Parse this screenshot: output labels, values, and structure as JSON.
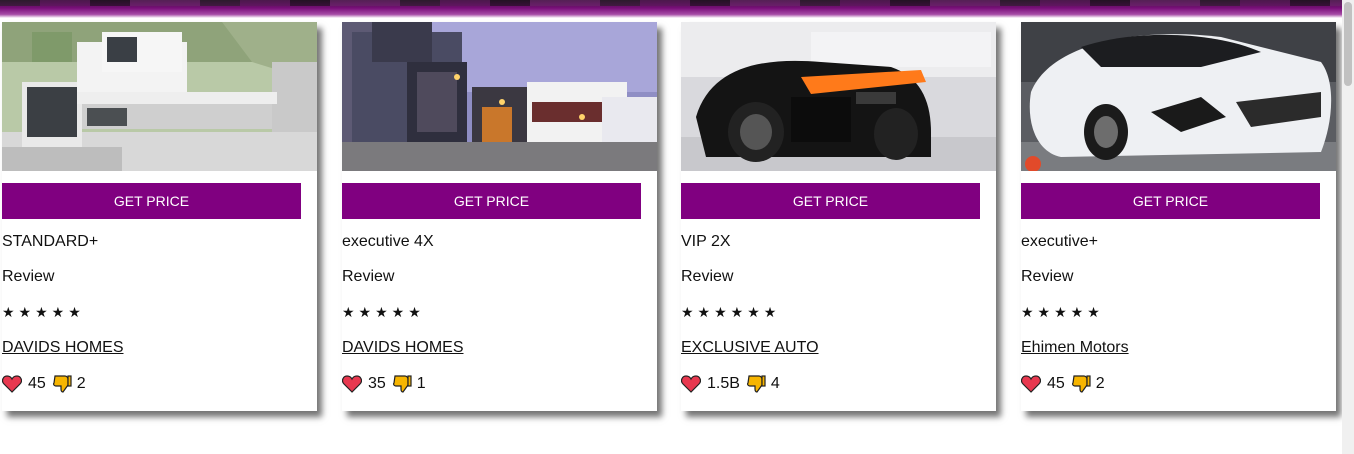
{
  "cards": [
    {
      "image_alt": "modern house",
      "button": "GET PRICE",
      "title": "STANDARD+",
      "review": "Review",
      "stars": "★★★★★",
      "seller": "DAVIDS HOMES",
      "likes": "45",
      "dislikes": "2"
    },
    {
      "image_alt": "house at dusk",
      "button": "GET PRICE",
      "title": "executive 4X",
      "review": "Review",
      "stars": "★★★★★",
      "seller": "DAVIDS HOMES",
      "likes": "35",
      "dislikes": "1"
    },
    {
      "image_alt": "black sports car",
      "button": "GET PRICE",
      "title": "VIP 2X",
      "review": "Review",
      "stars": "★★★★★★",
      "seller": "EXCLUSIVE AUTO",
      "likes": "1.5B",
      "dislikes": "4"
    },
    {
      "image_alt": "white sports car",
      "button": "GET PRICE",
      "title": "executive+",
      "review": "Review",
      "stars": "★★★★★",
      "seller": "Ehimen Motors",
      "likes": "45",
      "dislikes": "2"
    }
  ],
  "colors": {
    "button": "#800080",
    "accent": "#a64ca6"
  },
  "icons": {
    "like": "heart-icon",
    "dislike": "thumbs-down-icon"
  }
}
